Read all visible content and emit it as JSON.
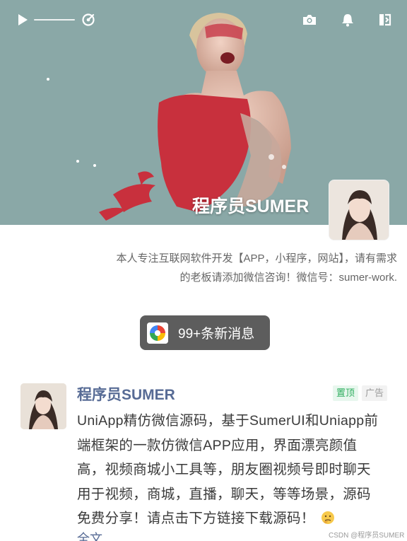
{
  "header": {
    "icons": [
      "play-icon",
      "playback-speed-icon",
      "camera-icon",
      "bell-icon",
      "exit-icon"
    ],
    "playback_progress": 0
  },
  "profile": {
    "name": "程序员SUMER",
    "bio_lines": [
      "本人专注互联网软件开发【APP，小程序，网站】，请有需求",
      "的老板请添加微信咨询！微信号：sumer-work."
    ]
  },
  "notification": {
    "label": "99+条新消息"
  },
  "post": {
    "author": "程序员SUMER",
    "badges": {
      "top": "置顶",
      "ad": "广告"
    },
    "content_lines": [
      "UniApp精仿微信源码，基于SumerUI和Uniapp前",
      "端框架的一款仿微信APP应用，界面漂亮颜值",
      "高，视频商城小工具等，朋友圈视频号即时聊天",
      "用于视频，商城，直播，聊天，等等场景，源码",
      "免费分享！请点击下方链接下载源码！"
    ],
    "full_text_link": "全文"
  },
  "watermark": "CSDN @程序员SUMER",
  "colors": {
    "cover_bg": "#8aa8a7",
    "author_link": "#576b95",
    "badge_top": "#2fae5f",
    "pill_bg": "#5d5d5d"
  }
}
